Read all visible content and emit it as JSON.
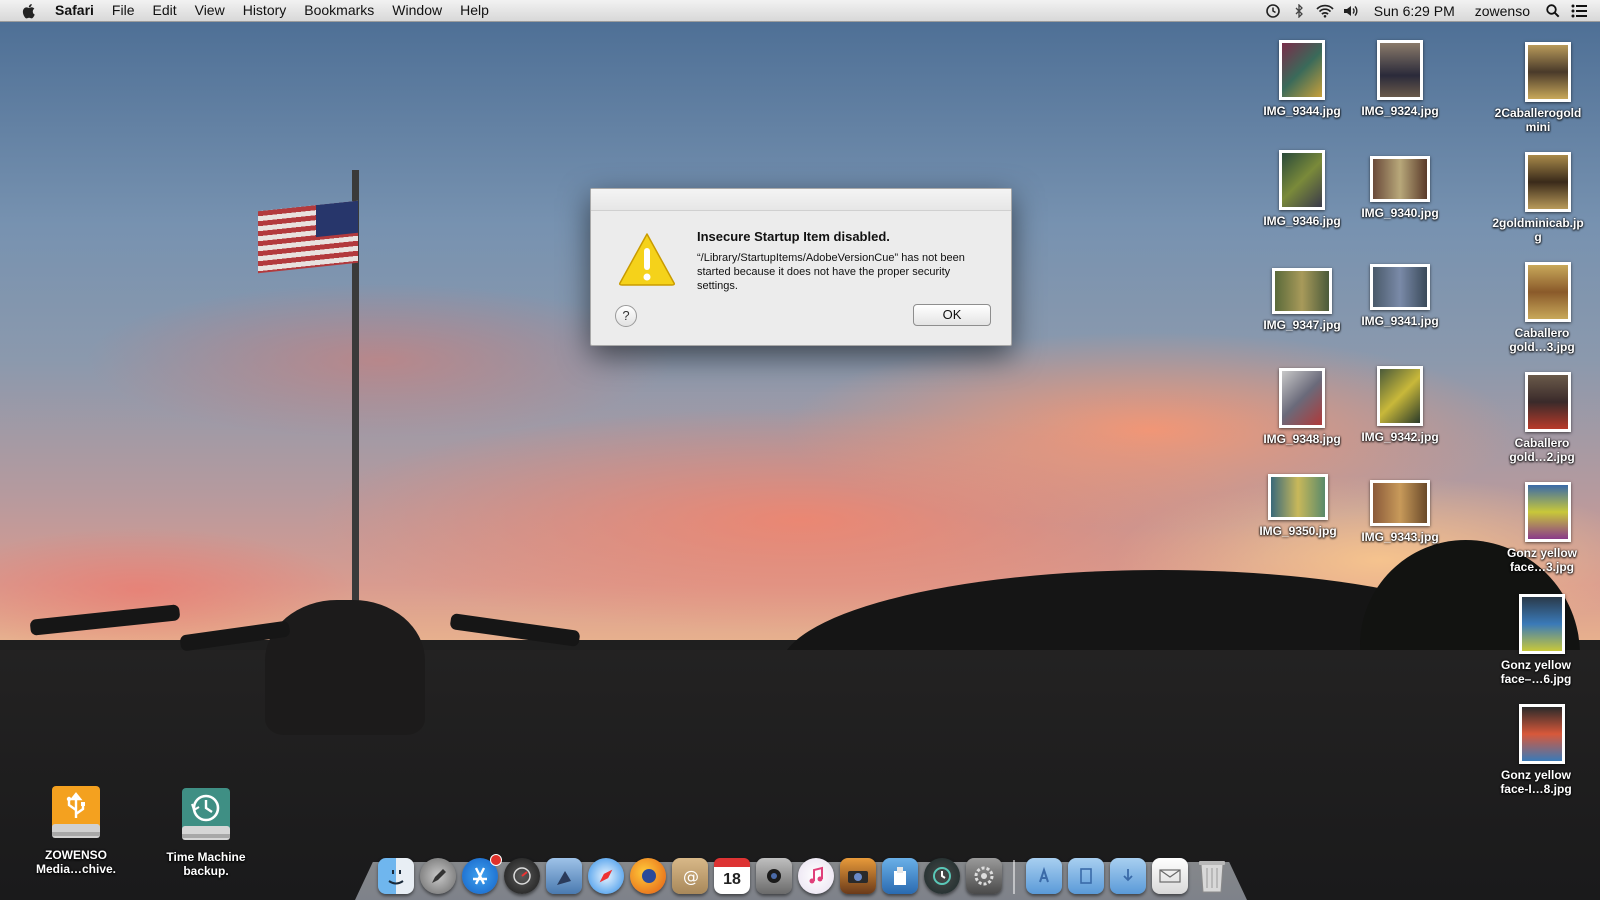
{
  "menubar": {
    "app_name": "Safari",
    "menus": [
      "File",
      "Edit",
      "View",
      "History",
      "Bookmarks",
      "Window",
      "Help"
    ],
    "clock": "Sun 6:29 PM",
    "user": "zowenso"
  },
  "dialog": {
    "title": "Insecure Startup Item disabled.",
    "message": "“/Library/StartupItems/AdobeVersionCue” has not been started because it does not have the proper security settings.",
    "help_label": "?",
    "ok_label": "OK"
  },
  "desktop": {
    "files": [
      {
        "name": "IMG_9344.jpg"
      },
      {
        "name": "IMG_9324.jpg"
      },
      {
        "name": "2Caballerogoldmini"
      },
      {
        "name": "IMG_9346.jpg"
      },
      {
        "name": "IMG_9340.jpg"
      },
      {
        "name": "2goldminicab.jpg"
      },
      {
        "name": "IMG_9347.jpg"
      },
      {
        "name": "IMG_9341.jpg"
      },
      {
        "name": "Caballero gold…3.jpg"
      },
      {
        "name": "IMG_9348.jpg"
      },
      {
        "name": "IMG_9342.jpg"
      },
      {
        "name": "Caballero gold…2.jpg"
      },
      {
        "name": "IMG_9350.jpg"
      },
      {
        "name": "IMG_9343.jpg"
      },
      {
        "name": "Gonz yellow face…3.jpg"
      },
      {
        "name": "Gonz yellow face–…6.jpg"
      },
      {
        "name": "Gonz yellow face-I…8.jpg"
      }
    ],
    "drives": [
      {
        "name": "ZOWENSO Media…chive."
      },
      {
        "name": "Time Machine backup."
      }
    ]
  },
  "dock": {
    "calendar_day": "18",
    "items": [
      "finder-icon",
      "launchpad-icon",
      "app-store-icon",
      "dashboard-icon",
      "preview-icon",
      "safari-icon",
      "firefox-icon",
      "contacts-icon",
      "calendar-icon",
      "photo-booth-icon",
      "itunes-icon",
      "iphoto-icon",
      "utility-icon",
      "time-machine-icon",
      "system-preferences-icon",
      "applications-folder-icon",
      "documents-folder-icon",
      "downloads-folder-icon",
      "mail-stack-icon",
      "trash-icon"
    ]
  }
}
